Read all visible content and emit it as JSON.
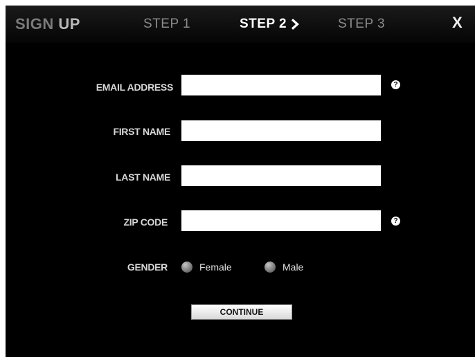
{
  "header": {
    "title_part1": "SIGN ",
    "title_part2": "UP",
    "steps": [
      {
        "label": "STEP 1",
        "active": false
      },
      {
        "label": "STEP 2",
        "active": true
      },
      {
        "label": "STEP 3",
        "active": false
      }
    ],
    "close_label": "X"
  },
  "form": {
    "fields": [
      {
        "label": "EMAIL ADDRESS",
        "value": "",
        "has_help": true
      },
      {
        "label": "FIRST NAME",
        "value": "",
        "has_help": false
      },
      {
        "label": "LAST NAME",
        "value": "",
        "has_help": false
      },
      {
        "label": "ZIP CODE",
        "value": "",
        "has_help": true
      }
    ],
    "help_glyph": "?",
    "gender": {
      "label": "GENDER",
      "options": [
        "Female",
        "Male"
      ]
    },
    "continue_label": "CONTINUE"
  },
  "colors": {
    "background": "#000000",
    "active_step": "#ffffff",
    "inactive_step": "#8c8c8c"
  }
}
